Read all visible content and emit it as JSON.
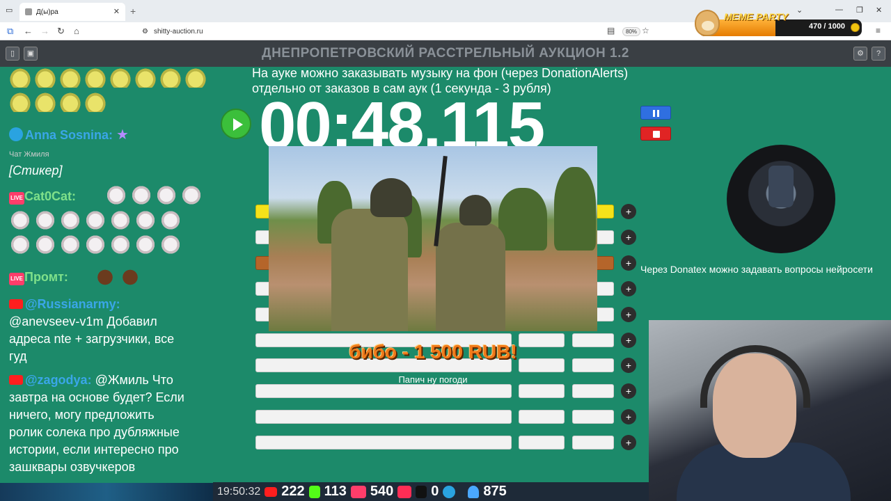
{
  "browser": {
    "tab_title": "Д(ы)ра",
    "url": "shitty-auction.ru",
    "zoom": "80%"
  },
  "meme_party": {
    "title": "MEME PARTY",
    "count": "470 / 1000",
    "progress": 0.47
  },
  "app": {
    "title": "ДНЕПРОПЕТРОВСКИЙ РАССТРЕЛЬНЫЙ АУКЦИОН 1.2",
    "info_line1": "На ауке можно заказывать музыку на фон (через DonationAlerts)",
    "info_line2": "отдельно от заказов в сам аук (1 секунда - 3 рубля)",
    "timer": "00:48.115"
  },
  "chat": {
    "msg1_user": "Anna Sosnina:",
    "msg1_sub": "Чат Жмиля",
    "msg1_text": "[Стикер]",
    "msg2_user": "Cat0Cat:",
    "msg3_user": "Промт:",
    "msg4_user": "@Russianarmy:",
    "msg4_text1": "@anevseev-v1m Добавил",
    "msg4_text2": "адреса nte + загрузчики, все",
    "msg4_text3": "гуд",
    "msg5_user": "@zagodya:",
    "msg5_text0": "@Жмиль Что",
    "msg5_text1": "завтра на основе будет? Если",
    "msg5_text2": "ничего, могу предложить",
    "msg5_text3": "ролик солека про дубляжные",
    "msg5_text4": "истории, если интересно про",
    "msg5_text5": "зашквары озвучкеров"
  },
  "donation": {
    "text": "бибо - 1 500 RUB!",
    "message": "Папич ну погоди"
  },
  "donatex_text": "Через Donatex можно задавать вопросы нейросети",
  "stats": {
    "time": "19:50:32",
    "youtube": "222",
    "kick": "113",
    "live": "540",
    "rutube": "0",
    "viewers": "875"
  },
  "colors": {
    "background": "#1c8a6a",
    "header": "#3a3f44",
    "play": "#3bbf3b",
    "pause": "#2f6fe0",
    "stop": "#e02424"
  }
}
